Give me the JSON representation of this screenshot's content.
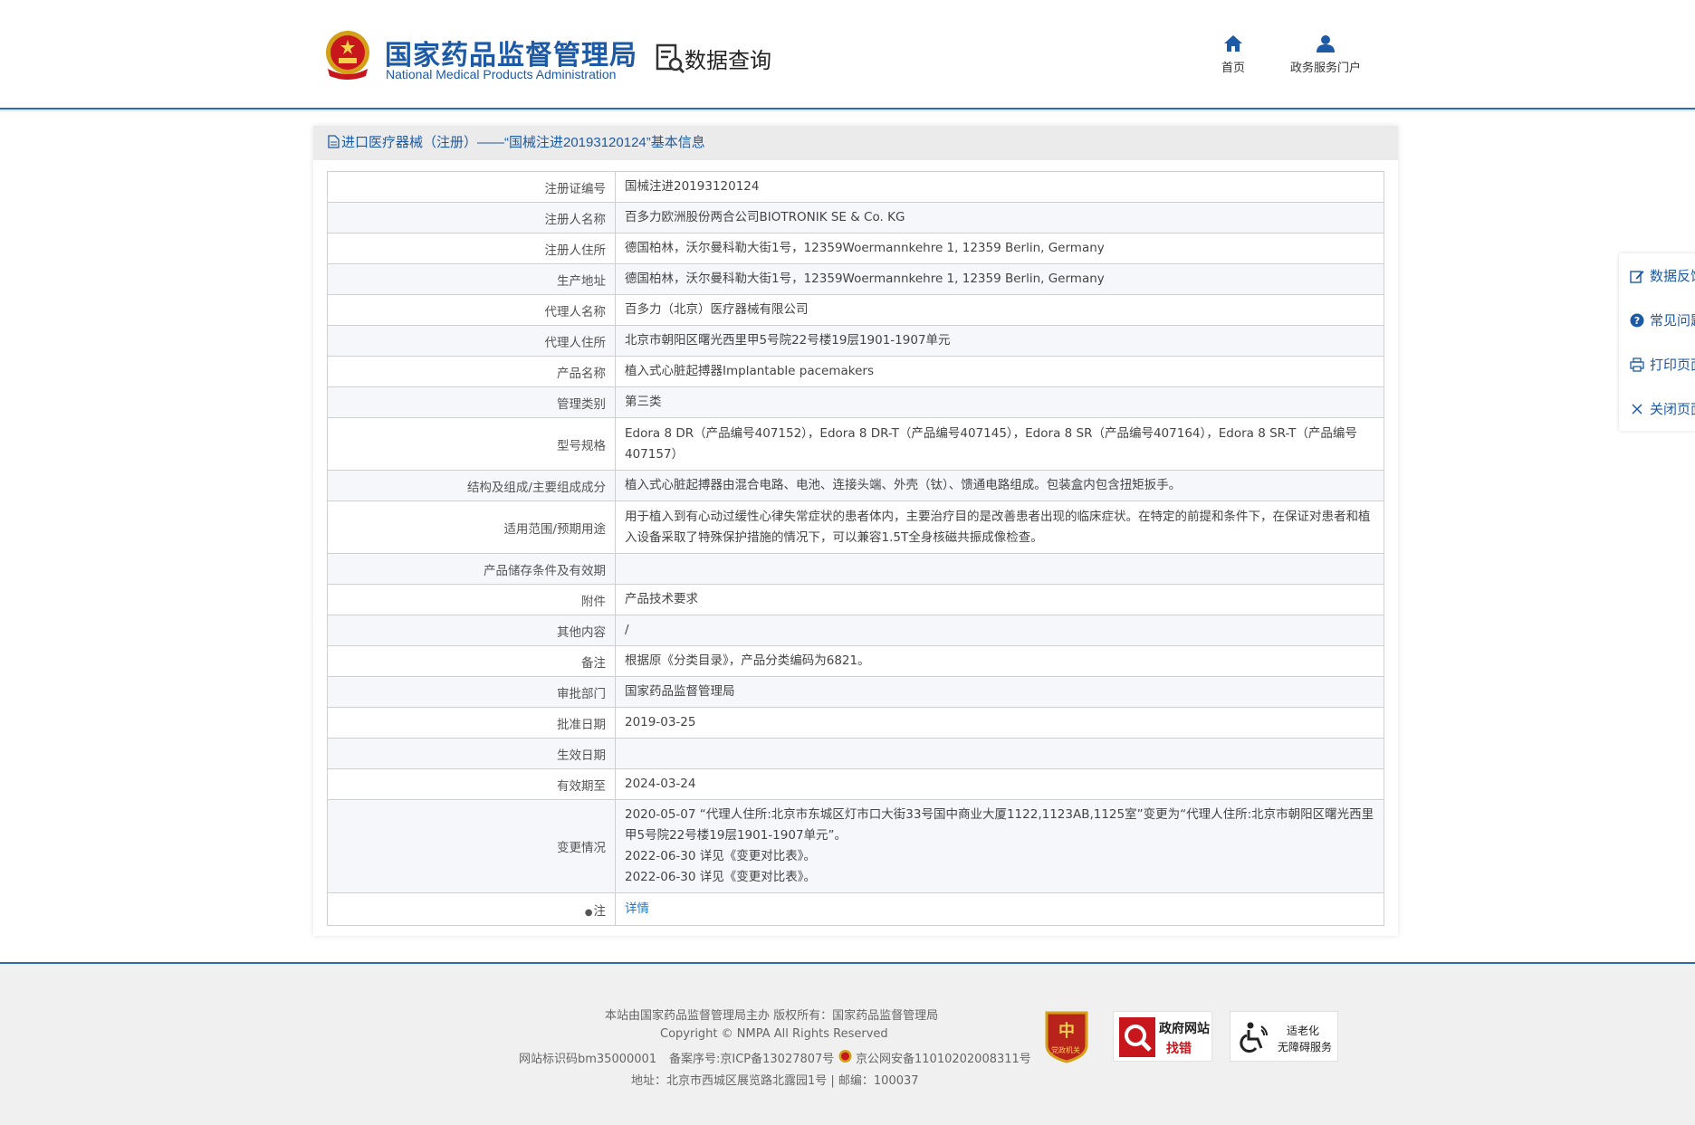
{
  "header": {
    "site_name_cn": "国家药品监督管理局",
    "site_name_en": "National Medical Products Administration",
    "section_title": "数据查询",
    "nav": [
      {
        "label": "首页",
        "icon": "home-icon"
      },
      {
        "label": "政务服务门户",
        "icon": "user-icon"
      }
    ]
  },
  "card": {
    "title": "进口医疗器械（注册）——“国械注进20193120124”基本信息",
    "rows": [
      {
        "key": "注册证编号",
        "value": "国械注进20193120124"
      },
      {
        "key": "注册人名称",
        "value": "百多力欧洲股份两合公司BIOTRONIK SE & Co. KG"
      },
      {
        "key": "注册人住所",
        "value": "德国柏林，沃尔曼科勒大街1号，12359Woermannkehre 1, 12359 Berlin, Germany"
      },
      {
        "key": "生产地址",
        "value": "德国柏林，沃尔曼科勒大街1号，12359Woermannkehre 1, 12359 Berlin, Germany"
      },
      {
        "key": "代理人名称",
        "value": "百多力（北京）医疗器械有限公司"
      },
      {
        "key": "代理人住所",
        "value": "北京市朝阳区曙光西里甲5号院22号楼19层1901-1907单元"
      },
      {
        "key": "产品名称",
        "value": "植入式心脏起搏器Implantable pacemakers"
      },
      {
        "key": "管理类别",
        "value": "第三类"
      },
      {
        "key": "型号规格",
        "value": "Edora 8 DR（产品编号407152），Edora 8 DR-T（产品编号407145），Edora 8 SR（产品编号407164），Edora 8 SR-T（产品编号407157）"
      },
      {
        "key": "结构及组成/主要组成成分",
        "value": "植入式心脏起搏器由混合电路、电池、连接头端、外壳（钛）、馈通电路组成。包装盒内包含扭矩扳手。"
      },
      {
        "key": "适用范围/预期用途",
        "value": "用于植入到有心动过缓性心律失常症状的患者体内，主要治疗目的是改善患者出现的临床症状。在特定的前提和条件下，在保证对患者和植入设备采取了特殊保护措施的情况下，可以兼容1.5T全身核磁共振成像检查。"
      },
      {
        "key": "产品储存条件及有效期",
        "value": ""
      },
      {
        "key": "附件",
        "value": "产品技术要求"
      },
      {
        "key": "其他内容",
        "value": "/"
      },
      {
        "key": "备注",
        "value": "根据原《分类目录》，产品分类编码为6821。"
      },
      {
        "key": "审批部门",
        "value": "国家药品监督管理局"
      },
      {
        "key": "批准日期",
        "value": "2019-03-25"
      },
      {
        "key": "生效日期",
        "value": ""
      },
      {
        "key": "有效期至",
        "value": "2024-03-24"
      }
    ],
    "changes": {
      "key": "变更情况",
      "lines": [
        "2020-05-07 “代理人住所:北京市东城区灯市口大街33号国中商业大厦1122,1123AB,1125室”变更为“代理人住所:北京市朝阳区曙光西里甲5号院22号楼19层1901-1907单元”。",
        "2022-06-30 详见《变更对比表》。",
        "2022-06-30 详见《变更对比表》。"
      ]
    },
    "note": {
      "key": "注",
      "link": "详情"
    }
  },
  "float_bar": [
    {
      "label": "数据反馈",
      "icon": "edit-icon"
    },
    {
      "label": "常见问题",
      "icon": "question-icon"
    },
    {
      "label": "打印页面",
      "icon": "print-icon"
    },
    {
      "label": "关闭页面",
      "icon": "close-icon"
    }
  ],
  "footer": {
    "line1": "本站由国家药品监督管理局主办 版权所有：国家药品监督管理局",
    "line2": "Copyright © NMPA All Rights Reserved",
    "site_id": "网站标识码bm35000001",
    "icp": "备案序号:京ICP备13027807号",
    "police": "京公网安备11010202008311号",
    "address": "地址：北京市西城区展览路北露园1号 | 邮编：100037",
    "badges": {
      "party": "党政机关",
      "gov_title": "政府网站",
      "gov_sub": "找错",
      "acc_title": "适老化",
      "acc_sub": "无障碍服务"
    }
  },
  "colors": {
    "brand": "#1c5aa6",
    "link": "#1f77d0",
    "footer_bg": "#f0f0f0"
  }
}
